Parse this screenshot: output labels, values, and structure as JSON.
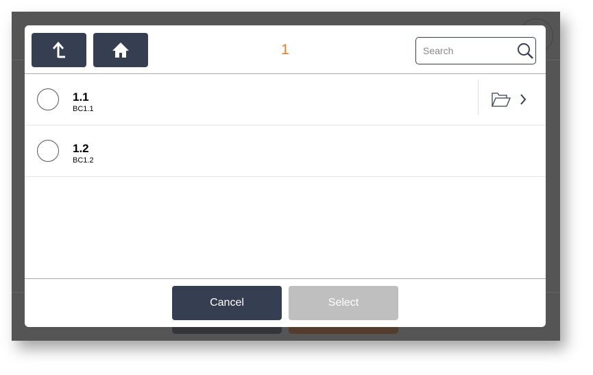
{
  "dialog": {
    "title": "1",
    "up_icon": "arrow-up-left-icon",
    "home_icon": "home-icon",
    "search": {
      "placeholder": "Search",
      "value": "",
      "icon": "search-icon"
    },
    "items": [
      {
        "name": "1.1",
        "code": "BC1.1",
        "has_children": true
      },
      {
        "name": "1.2",
        "code": "BC1.2",
        "has_children": false
      }
    ],
    "cancel_label": "Cancel",
    "select_label": "Select"
  },
  "colors": {
    "primary": "#353f51",
    "accent": "#f0781e",
    "disabled": "#bfbfbf"
  }
}
